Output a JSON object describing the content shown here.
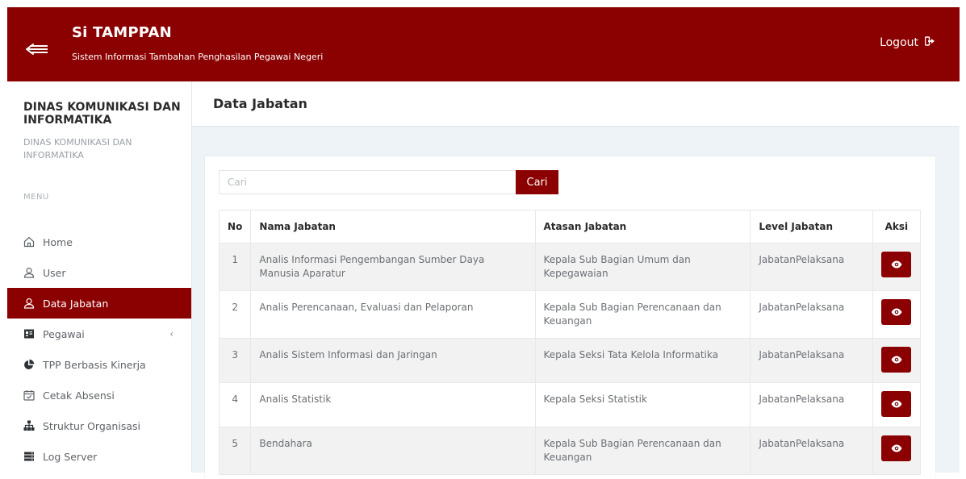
{
  "header": {
    "title": "Si TAMPPAN",
    "subtitle": "Sistem Informasi Tambahan Penghasilan Pegawai Negeri",
    "logout_label": "Logout"
  },
  "sidebar": {
    "org_name": "DINAS KOMUNIKASI DAN INFORMATIKA",
    "org_sub": "DINAS KOMUNIKASI DAN INFORMATIKA",
    "menu_label": "MENU",
    "items": [
      {
        "label": "Home",
        "icon": "home-icon"
      },
      {
        "label": "User",
        "icon": "user-icon"
      },
      {
        "label": "Data Jabatan",
        "icon": "user-icon",
        "active": true
      },
      {
        "label": "Pegawai",
        "icon": "id-card-icon",
        "has_caret": true
      },
      {
        "label": "TPP Berbasis Kinerja",
        "icon": "pie-chart-icon"
      },
      {
        "label": "Cetak Absensi",
        "icon": "calendar-check-icon"
      },
      {
        "label": "Struktur Organisasi",
        "icon": "sitemap-icon"
      },
      {
        "label": "Log Server",
        "icon": "server-icon"
      }
    ]
  },
  "page": {
    "title": "Data Jabatan"
  },
  "search": {
    "placeholder": "Cari",
    "value": "",
    "button_label": "Cari"
  },
  "table": {
    "headers": [
      "No",
      "Nama Jabatan",
      "Atasan Jabatan",
      "Level Jabatan",
      "Aksi"
    ],
    "rows": [
      {
        "no": "1",
        "nama": "Analis Informasi Pengembangan Sumber Daya Manusia Aparatur",
        "atasan": "Kepala Sub Bagian Umum dan Kepegawaian",
        "level": "JabatanPelaksana"
      },
      {
        "no": "2",
        "nama": "Analis Perencanaan, Evaluasi dan Pelaporan",
        "atasan": "Kepala Sub Bagian Perencanaan dan Keuangan",
        "level": "JabatanPelaksana"
      },
      {
        "no": "3",
        "nama": "Analis Sistem Informasi dan Jaringan",
        "atasan": "Kepala Seksi Tata Kelola Informatika",
        "level": "JabatanPelaksana"
      },
      {
        "no": "4",
        "nama": "Analis Statistik",
        "atasan": "Kepala Seksi Statistik",
        "level": "JabatanPelaksana"
      },
      {
        "no": "5",
        "nama": "Bendahara",
        "atasan": "Kepala Sub Bagian Perencanaan dan Keuangan",
        "level": "JabatanPelaksana"
      }
    ]
  },
  "colors": {
    "brand": "#8b0000",
    "background": "#eef3f8"
  }
}
